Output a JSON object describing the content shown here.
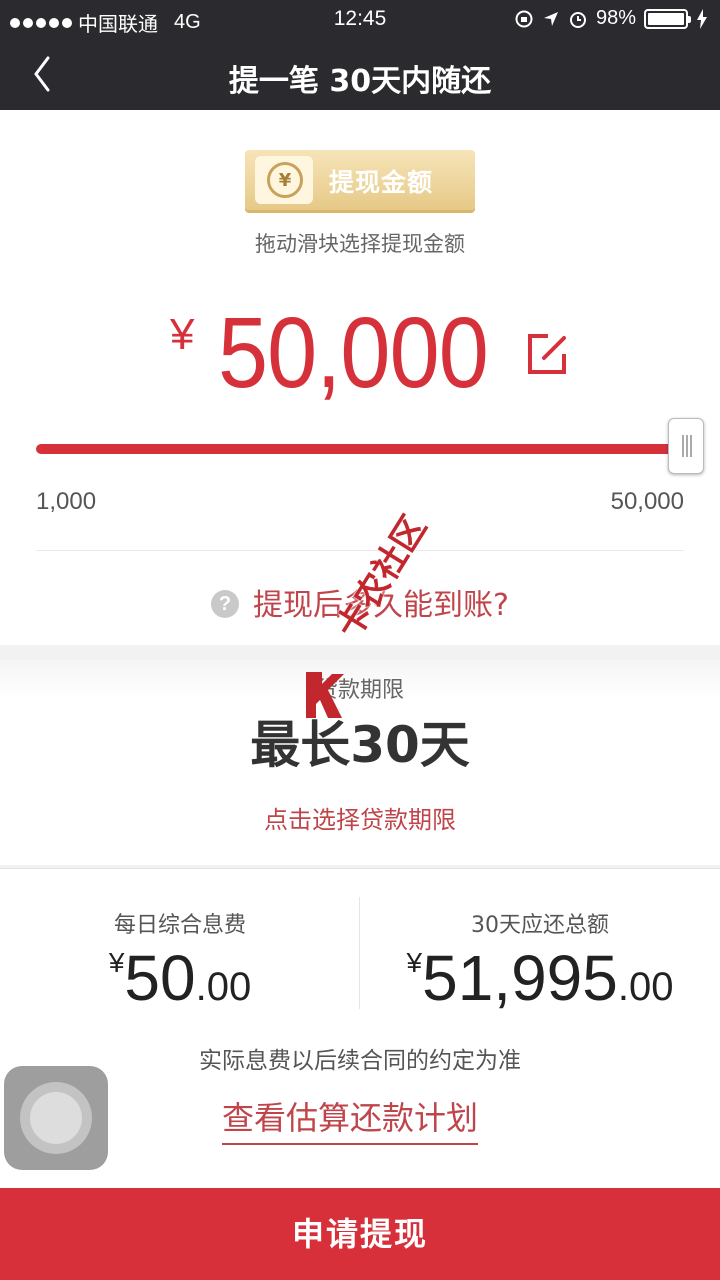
{
  "status_bar": {
    "carrier": "中国联通",
    "network": "4G",
    "time": "12:45",
    "battery": "98%"
  },
  "nav": {
    "title": "提一笔 30天内随还"
  },
  "amount_section": {
    "badge_label": "提现金额",
    "badge_icon_symbol": "¥",
    "hint": "拖动滑块选择提现金额",
    "currency": "¥",
    "amount": "50,000",
    "slider_fraction": 1.0,
    "min": "1,000",
    "max": "50,000",
    "faq_icon": "?",
    "faq": "提现后多久能到账?"
  },
  "term_section": {
    "label": "贷款期限",
    "value": "最长30天",
    "link": "点击选择贷款期限"
  },
  "fees": {
    "daily": {
      "label": "每日综合息费",
      "currency": "¥",
      "integer": "50",
      "decimal": ".00"
    },
    "total": {
      "label": "30天应还总额",
      "currency": "¥",
      "integer": "51,995",
      "decimal": ".00"
    },
    "note": "实际息费以后续合同的约定为准",
    "plan_link": "查看估算还款计划"
  },
  "submit": "申请提现",
  "watermark": "卡农社区",
  "colors": {
    "accent": "#d6313b",
    "topbar": "#2b2b2f",
    "badge_gold": "#e6c987"
  }
}
